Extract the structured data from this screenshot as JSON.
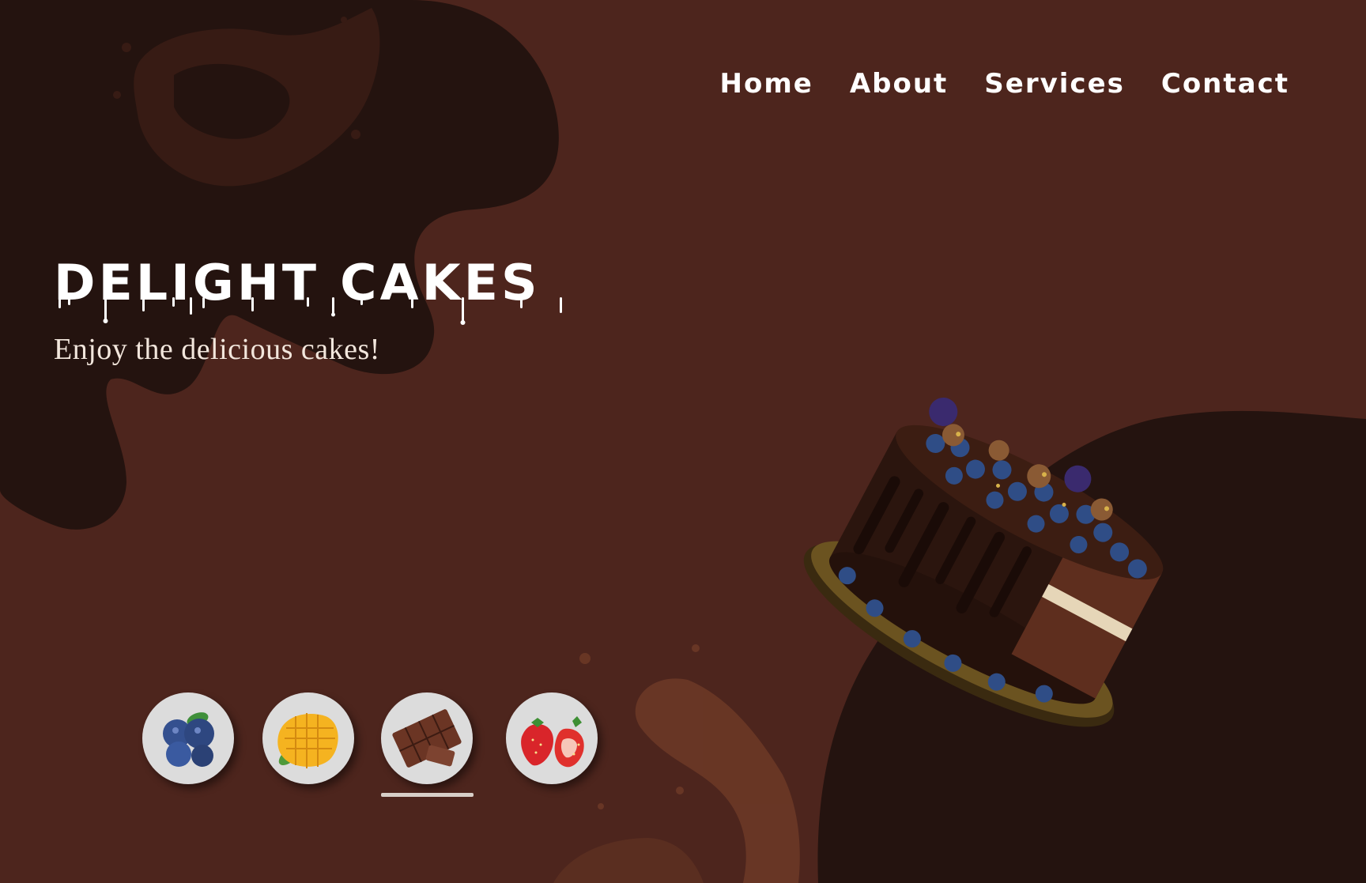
{
  "nav": {
    "items": [
      {
        "label": "Home"
      },
      {
        "label": "About"
      },
      {
        "label": "Services"
      },
      {
        "label": "Contact"
      }
    ]
  },
  "hero": {
    "title": "DELIGHT CAKES",
    "subtitle": "Enjoy the delicious cakes!"
  },
  "flavors": [
    {
      "icon": "blueberry-icon"
    },
    {
      "icon": "mango-icon"
    },
    {
      "icon": "chocolate-icon",
      "selected": true
    },
    {
      "icon": "strawberry-icon"
    }
  ],
  "colors": {
    "background": "#4d251d",
    "dark_blob": "#24130f",
    "text": "#ffffff"
  }
}
